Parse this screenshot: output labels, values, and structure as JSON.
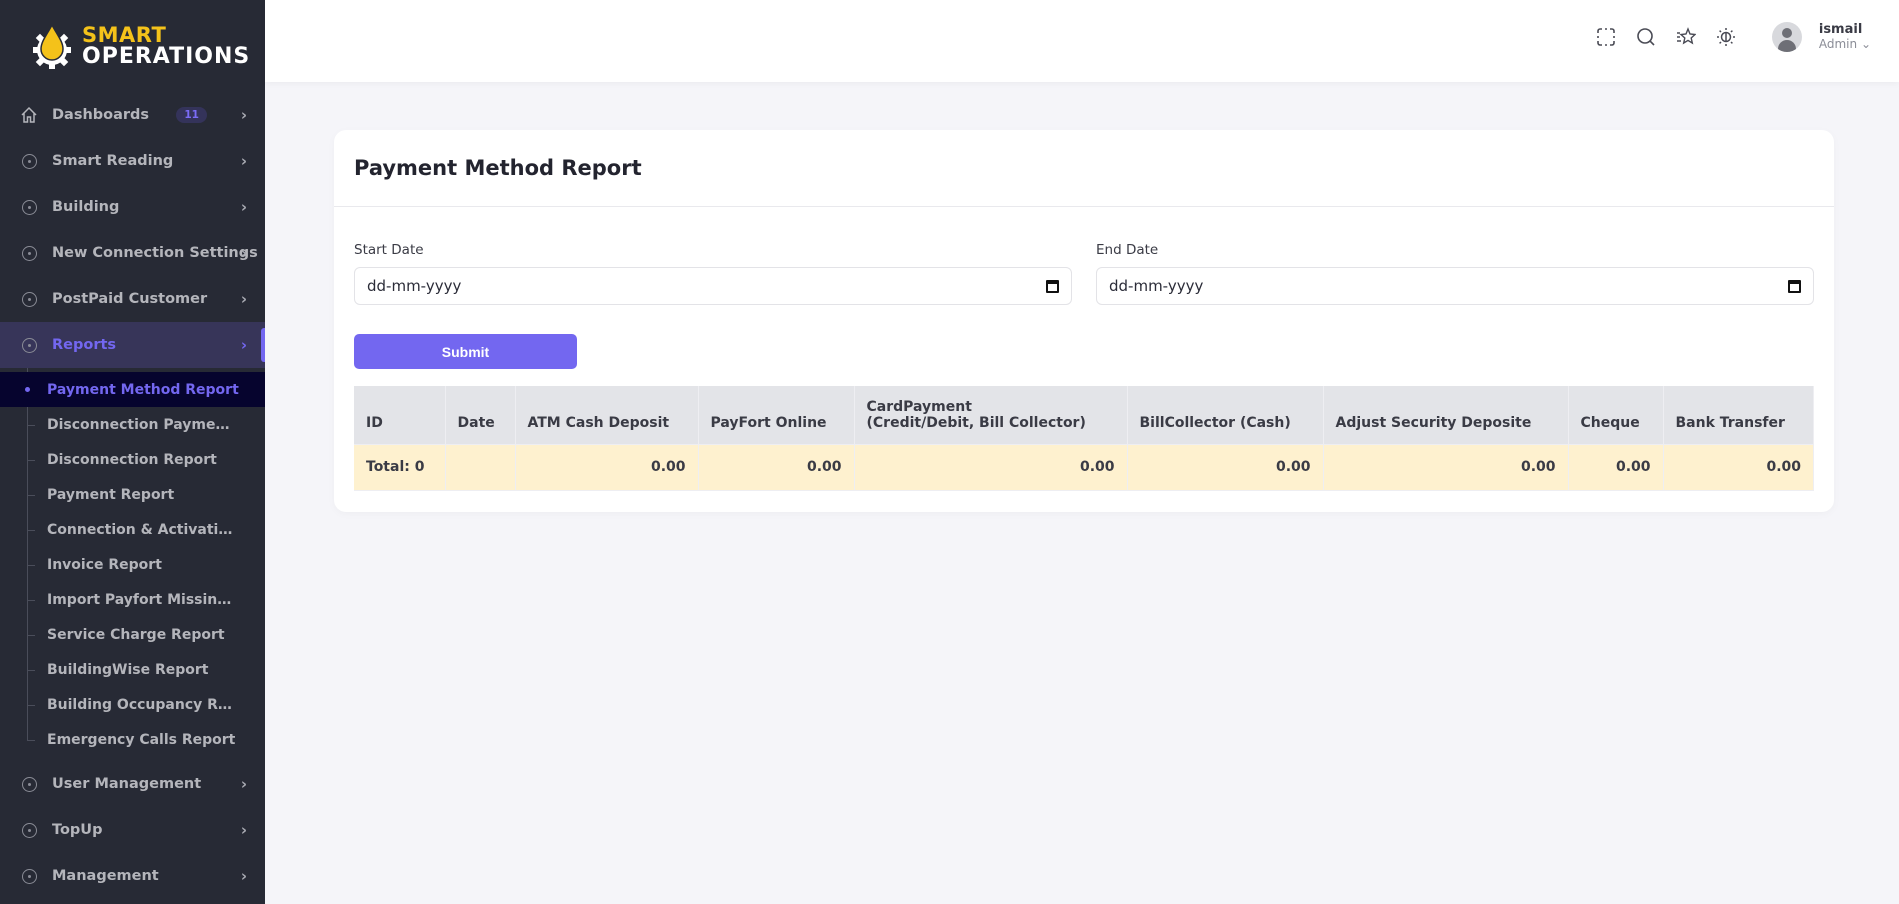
{
  "brand": {
    "line1": "SMART",
    "line2": "OPERATIONS",
    "accent": "#f4c21a"
  },
  "sidebar": {
    "items": [
      {
        "label": "Dashboards",
        "icon": "home-icon",
        "badge": "11"
      },
      {
        "label": "Smart Reading",
        "icon": "circle-icon"
      },
      {
        "label": "Building",
        "icon": "circle-icon"
      },
      {
        "label": "New Connection Settings",
        "icon": "circle-icon"
      },
      {
        "label": "PostPaid Customer",
        "icon": "circle-icon"
      },
      {
        "label": "Reports",
        "icon": "circle-icon",
        "active": true
      }
    ],
    "reports_sub": [
      {
        "label": "Payment Method Report",
        "active": true
      },
      {
        "label": "Disconnection Payment Report"
      },
      {
        "label": "Disconnection Report"
      },
      {
        "label": "Payment Report"
      },
      {
        "label": "Connection & Activation Report"
      },
      {
        "label": "Invoice Report"
      },
      {
        "label": "Import Payfort Missing Payments"
      },
      {
        "label": "Service Charge Report"
      },
      {
        "label": "BuildingWise Report"
      },
      {
        "label": "Building Occupancy Report"
      },
      {
        "label": "Emergency Calls Report"
      }
    ],
    "items_after": [
      {
        "label": "User Management",
        "icon": "circle-icon"
      },
      {
        "label": "TopUp",
        "icon": "circle-icon"
      },
      {
        "label": "Management",
        "icon": "circle-icon"
      }
    ]
  },
  "header": {
    "icons": [
      "fullscreen-icon",
      "search-icon",
      "shortcuts-star-icon",
      "theme-sun-icon"
    ],
    "user": {
      "name": "ismail",
      "role": "Admin"
    }
  },
  "page": {
    "title": "Payment Method Report",
    "start_label": "Start Date",
    "start_placeholder": "dd-mm-yyyy",
    "end_label": "End Date",
    "end_placeholder": "dd-mm-yyyy",
    "submit_label": "Submit"
  },
  "table": {
    "columns": [
      "ID",
      "Date",
      "ATM Cash Deposit",
      "PayFort Online",
      "CardPayment\n(Credit/Debit, Bill Collector)",
      "BillCollector (Cash)",
      "Adjust Security Deposite",
      "Cheque",
      "Bank Transfer"
    ],
    "total_row": [
      "Total: 0",
      "",
      "0.00",
      "0.00",
      "0.00",
      "0.00",
      "0.00",
      "0.00",
      "0.00"
    ]
  },
  "colors": {
    "primary": "#7367f0",
    "sidebar_bg": "#272a35",
    "total_row_bg": "#fef1cf"
  }
}
